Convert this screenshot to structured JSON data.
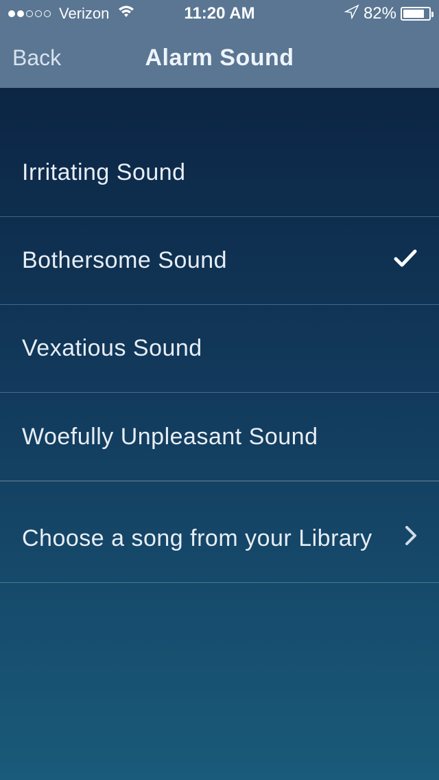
{
  "statusBar": {
    "carrier": "Verizon",
    "time": "11:20 AM",
    "batteryPercent": "82%",
    "batteryFill": 82
  },
  "nav": {
    "back": "Back",
    "title": "Alarm Sound"
  },
  "sounds": [
    {
      "label": "Irritating Sound",
      "selected": false
    },
    {
      "label": "Bothersome Sound",
      "selected": true
    },
    {
      "label": "Vexatious Sound",
      "selected": false
    },
    {
      "label": "Woefully Unpleasant Sound",
      "selected": false
    }
  ],
  "library": {
    "label": "Choose a song from your Library"
  }
}
